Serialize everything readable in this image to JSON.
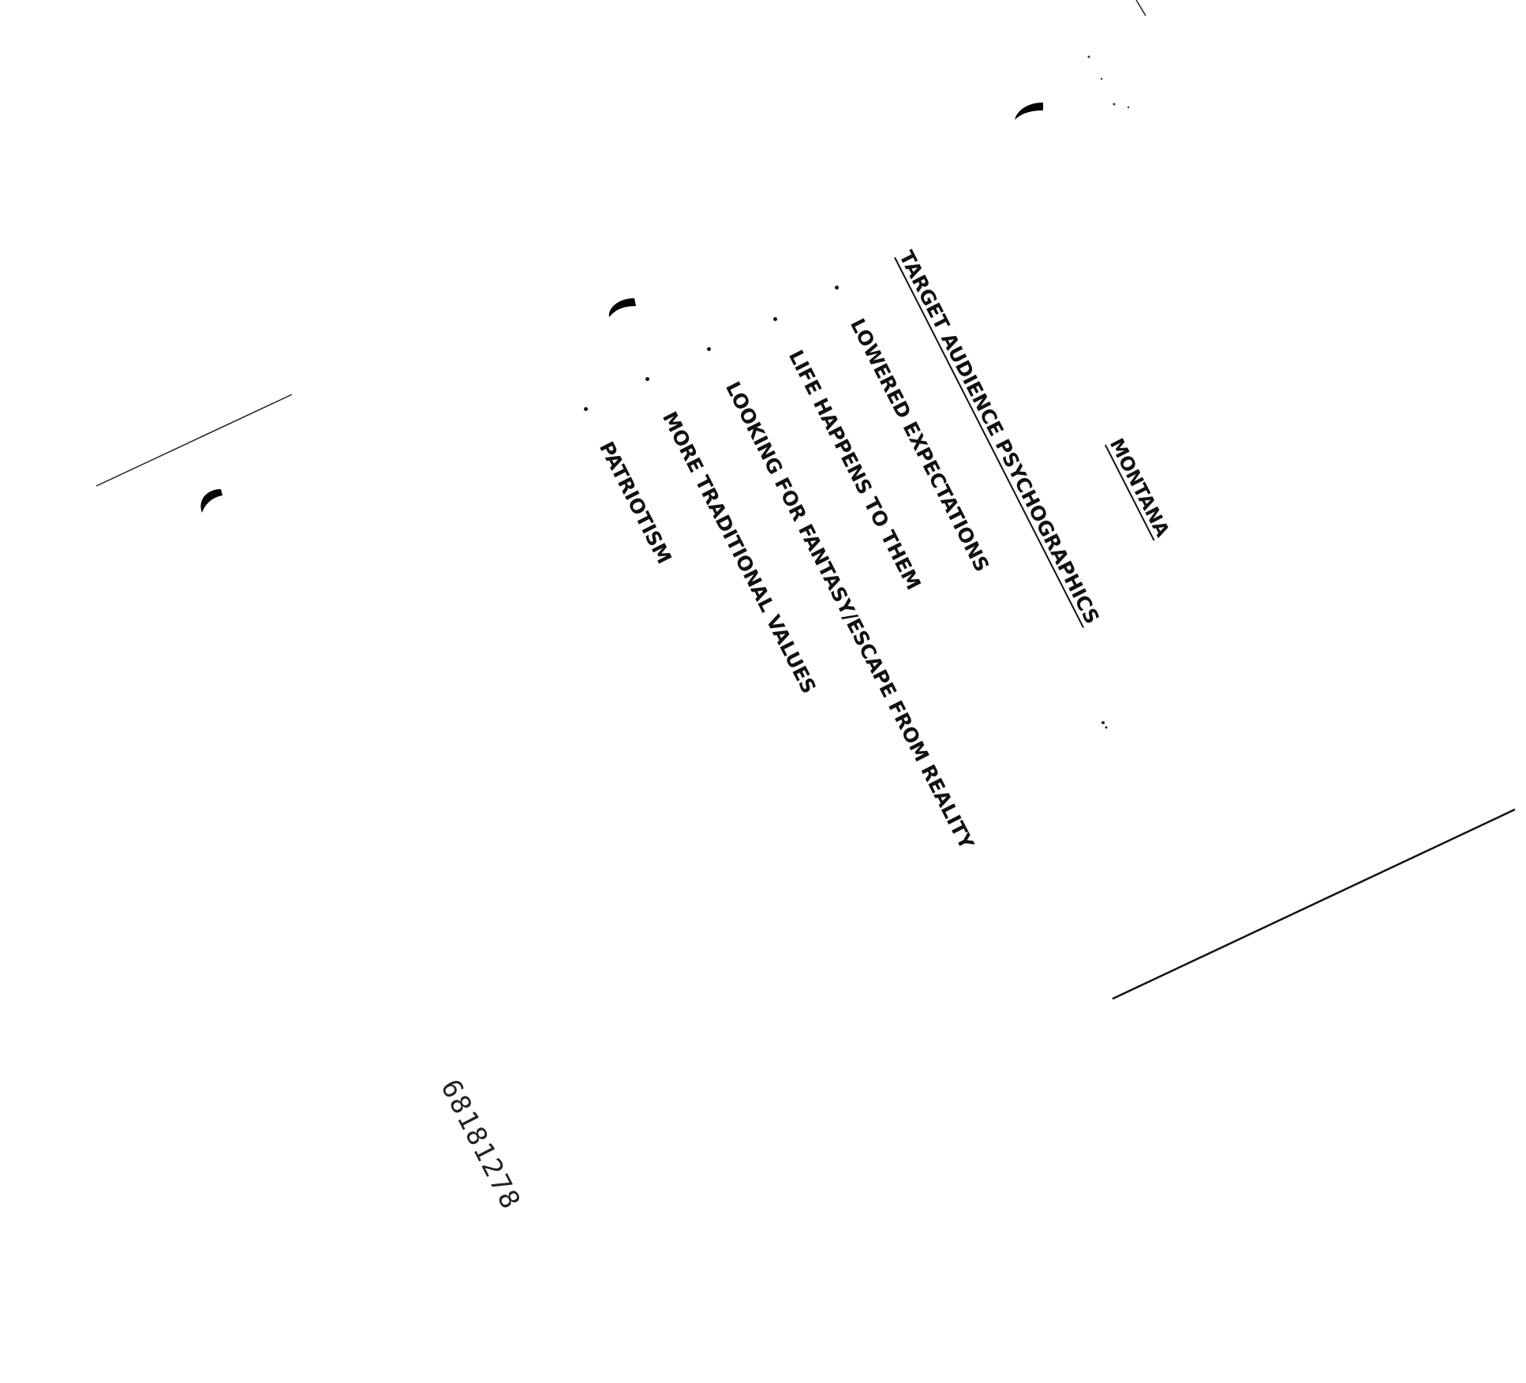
{
  "document": {
    "heading": "MONTANA",
    "section_title": "TARGET AUDIENCE PSYCHOGRAPHICS",
    "items": [
      "LOWERED EXPECTATIONS",
      "LIFE HAPPENS TO THEM",
      "LOOKING FOR FANTASY/ESCAPE FROM REALITY",
      "MORE TRADITIONAL VALUES",
      "PATRIOTISM"
    ],
    "doc_number": "68181278"
  }
}
